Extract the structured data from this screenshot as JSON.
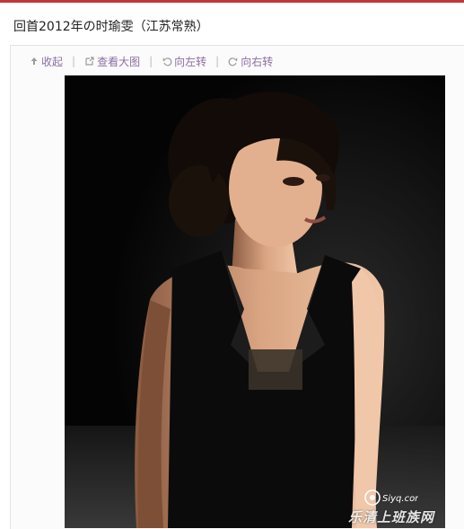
{
  "post": {
    "title": "回首2012年の时瑜雯（江苏常熟）"
  },
  "toolbar": {
    "items": [
      {
        "label": "收起",
        "icon": "collapse-up-icon"
      },
      {
        "label": "查看大图",
        "icon": "open-large-icon"
      },
      {
        "label": "向左转",
        "icon": "rotate-left-icon"
      },
      {
        "label": "向右转",
        "icon": "rotate-right-icon"
      }
    ],
    "separator": "|"
  },
  "photo": {
    "watermark": "乐清上班族网",
    "logo_text": "Siyq.com"
  },
  "colors": {
    "accent": "#c0393b",
    "link": "#8d6ea1",
    "title": "#222222"
  }
}
